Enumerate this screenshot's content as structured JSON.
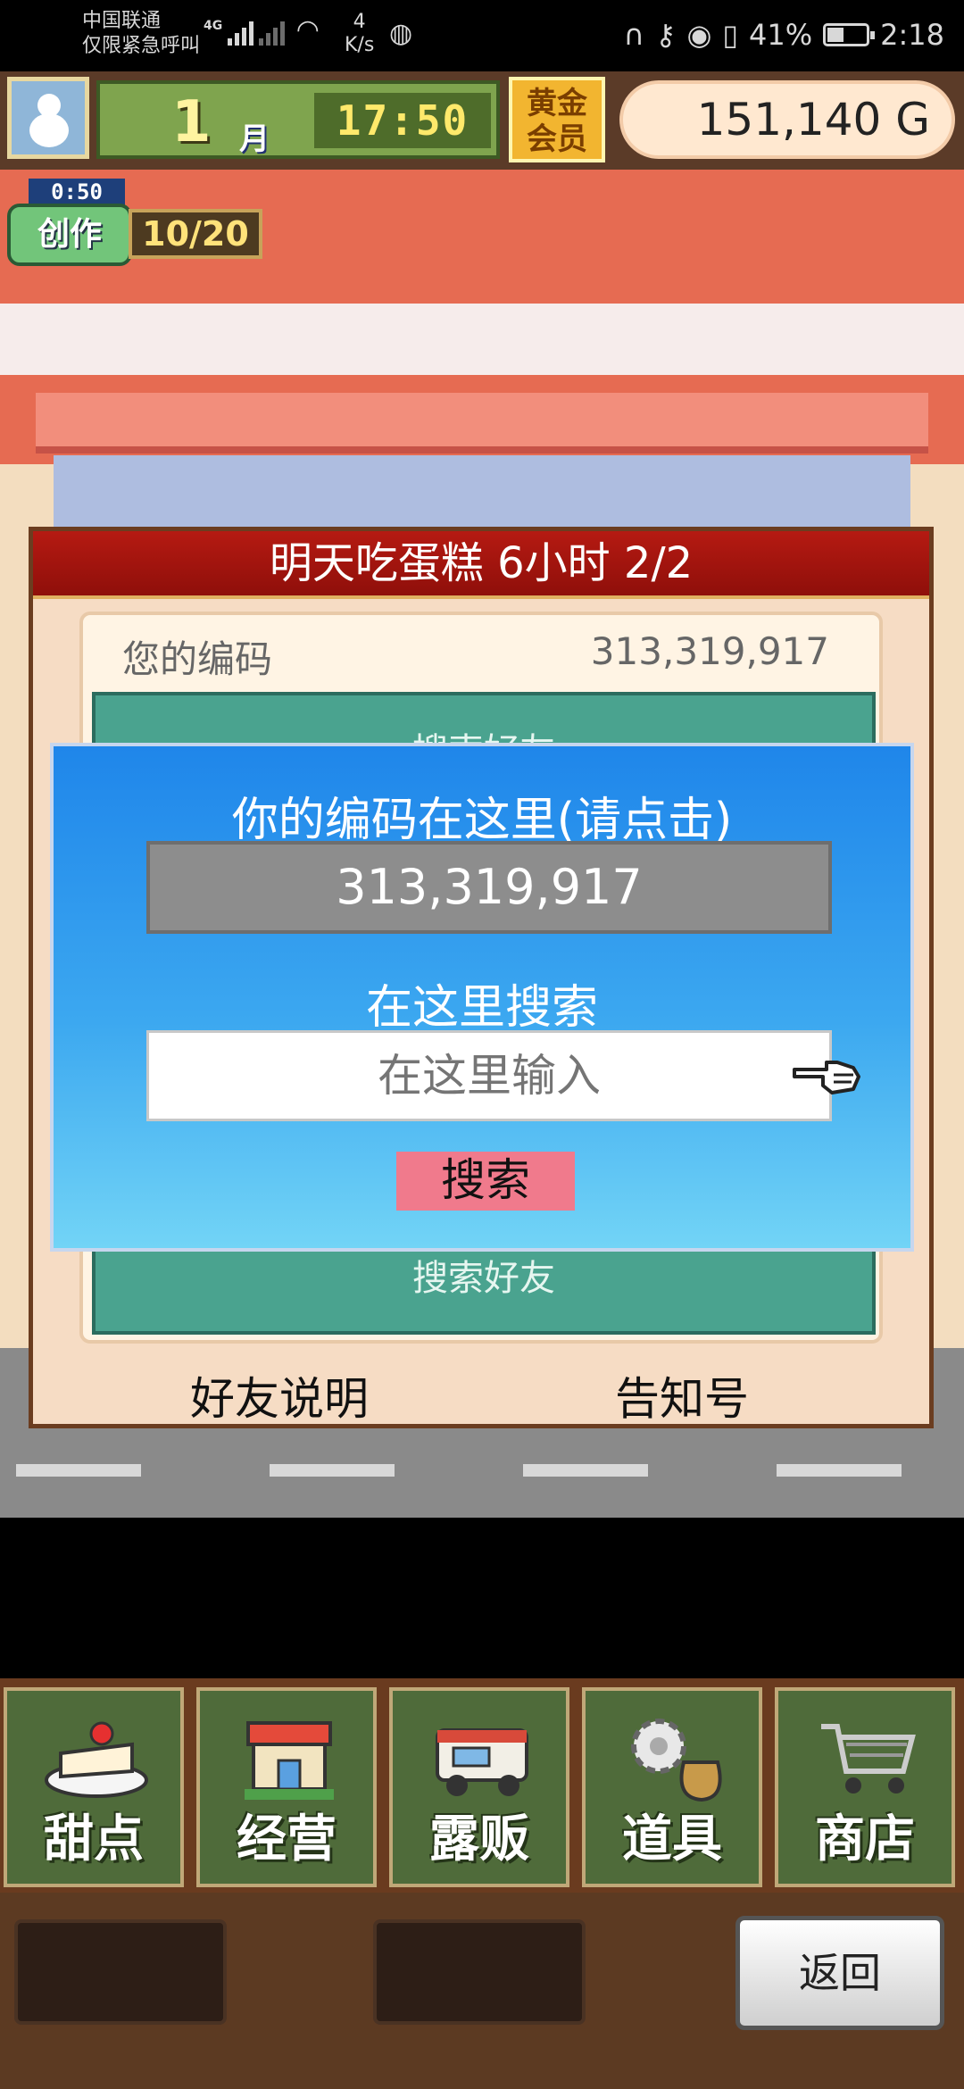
{
  "status_bar": {
    "carrier_line1": "中国联通",
    "carrier_line2": "仅限紧急呼叫",
    "network": "4G",
    "speed_value": "4",
    "speed_unit": "K/s",
    "battery": "41%",
    "time": "2:18"
  },
  "hud": {
    "month_number": "1",
    "month_label": "月",
    "clock": "17:50",
    "membership": "黄金会员",
    "money": "151,140 G"
  },
  "creation": {
    "timer": "0:50",
    "label": "创作",
    "count": "10/20"
  },
  "friend_dialog": {
    "title": "明天吃蛋糕  6小时 2/2",
    "your_code_label": "您的编码",
    "your_code_value": "313,319,917",
    "panel_header": "搜索好友",
    "panel_footer": "搜索好友",
    "friend_help": "好友说明",
    "notice": "告知号"
  },
  "search_popup": {
    "title": "你的编码在这里(请点击)",
    "code": "313,319,917",
    "search_label": "在这里搜索",
    "input_placeholder": "在这里输入",
    "input_value": "",
    "search_button": "搜索"
  },
  "menu": {
    "items": [
      {
        "label": "甜点",
        "icon": "cake-icon"
      },
      {
        "label": "经营",
        "icon": "shop-building-icon"
      },
      {
        "label": "露贩",
        "icon": "food-truck-icon"
      },
      {
        "label": "道具",
        "icon": "gear-bag-icon"
      },
      {
        "label": "商店",
        "icon": "shopping-cart-icon"
      }
    ]
  },
  "bottom": {
    "back_button": "返回"
  }
}
